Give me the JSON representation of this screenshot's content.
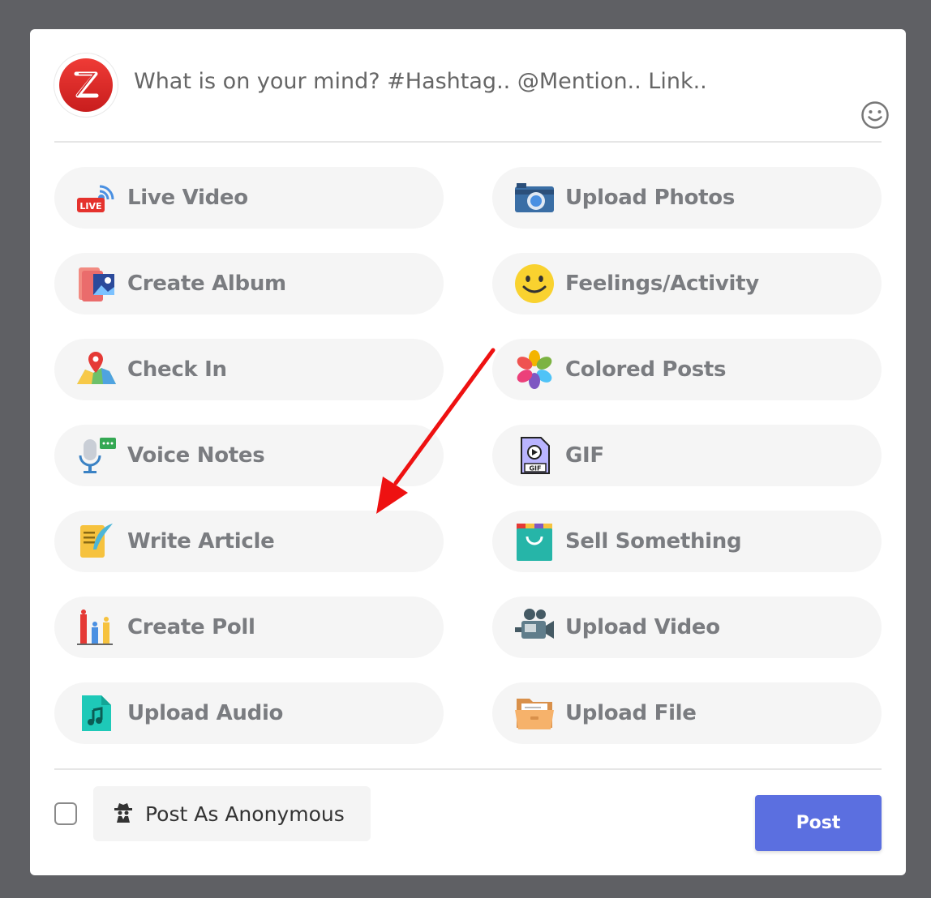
{
  "composer": {
    "placeholder": "What is on your mind? #Hashtag.. @Mention.. Link.."
  },
  "options": {
    "left": [
      {
        "label": "Live Video",
        "icon": "live-video-icon"
      },
      {
        "label": "Create Album",
        "icon": "album-icon"
      },
      {
        "label": "Check In",
        "icon": "map-pin-icon"
      },
      {
        "label": "Voice Notes",
        "icon": "microphone-icon"
      },
      {
        "label": "Write Article",
        "icon": "article-icon"
      },
      {
        "label": "Create Poll",
        "icon": "poll-icon"
      },
      {
        "label": "Upload Audio",
        "icon": "audio-file-icon"
      }
    ],
    "right": [
      {
        "label": "Upload Photos",
        "icon": "camera-icon"
      },
      {
        "label": "Feelings/Activity",
        "icon": "smiley-icon"
      },
      {
        "label": "Colored Posts",
        "icon": "color-flower-icon"
      },
      {
        "label": "GIF",
        "icon": "gif-file-icon"
      },
      {
        "label": "Sell Something",
        "icon": "shopping-bag-icon"
      },
      {
        "label": "Upload Video",
        "icon": "video-camera-icon"
      },
      {
        "label": "Upload File",
        "icon": "folder-icon"
      }
    ]
  },
  "footer": {
    "anonymous_label": "Post As Anonymous",
    "post_label": "Post"
  },
  "colors": {
    "accent": "#5b6fe0",
    "overlay": "#5f6064",
    "annotation_arrow": "#ee1111"
  }
}
